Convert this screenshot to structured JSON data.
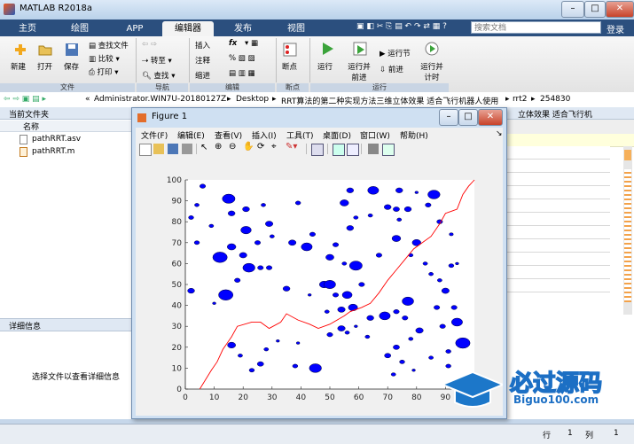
{
  "window": {
    "title": "MATLAB R2018a",
    "minimize": "–",
    "maximize": "□",
    "close": "✕"
  },
  "tabs": [
    {
      "label": "主页"
    },
    {
      "label": "绘图"
    },
    {
      "label": "APP"
    },
    {
      "label": "编辑器"
    },
    {
      "label": "发布"
    },
    {
      "label": "视图"
    }
  ],
  "search": {
    "placeholder": "搜索文档"
  },
  "login": "登录",
  "ribbon": {
    "file": {
      "new": "新建",
      "open": "打开",
      "save": "保存",
      "find_files": "查找文件",
      "compare": "比较",
      "print": "打印",
      "group": "文件"
    },
    "nav": {
      "goto": "转至",
      "find": "查找",
      "group": "导航"
    },
    "edit": {
      "insert": "插入",
      "comment": "注释",
      "indent": "缩进",
      "group": "编辑"
    },
    "breakpoints": {
      "label": "断点",
      "group": "断点"
    },
    "run": {
      "run": "运行",
      "run_advance": "运行并前进",
      "run_section": "运行节",
      "advance": "前进",
      "run_time": "运行并计时",
      "group": "运行"
    }
  },
  "address": {
    "crumbs": [
      "«",
      "Administrator.WIN7U-20180127Z",
      "Desktop",
      "RRT算法的第二种实现方法三维立体效果 适合飞行机器人使用",
      "rrt2",
      "254830"
    ]
  },
  "left_panel": {
    "title": "当前文件夹",
    "name_col": "名称",
    "files": [
      {
        "name": "pathRRT.asv"
      },
      {
        "name": "pathRRT.m"
      }
    ],
    "details_title": "详细信息",
    "details_hint": "选择文件以查看详细信息"
  },
  "right_panel": {
    "tab_text": "立体效果 适合飞行机"
  },
  "status": {
    "row_label": "行",
    "row": "1",
    "col_label": "列",
    "col": "1"
  },
  "figure": {
    "title": "Figure 1",
    "menus": [
      "文件(F)",
      "编辑(E)",
      "查看(V)",
      "插入(I)",
      "工具(T)",
      "桌面(D)",
      "窗口(W)",
      "帮助(H)"
    ]
  },
  "watermark": {
    "title": "必过源码",
    "url": "Biguo100.com"
  },
  "chart_data": {
    "type": "scatter",
    "xlim": [
      0,
      100
    ],
    "ylim": [
      0,
      100
    ],
    "xticks": [
      0,
      10,
      20,
      30,
      40,
      50,
      60,
      70,
      80,
      90
    ],
    "yticks": [
      0,
      10,
      20,
      30,
      40,
      50,
      60,
      70,
      80,
      90,
      100
    ],
    "grid": false,
    "obstacle_color": "#0000ff",
    "path_color": "#ff0000",
    "obstacles": [
      {
        "x": 6,
        "y": 97,
        "r": 1.0
      },
      {
        "x": 4,
        "y": 88,
        "r": 0.8
      },
      {
        "x": 2,
        "y": 82,
        "r": 0.9
      },
      {
        "x": 15,
        "y": 91,
        "r": 2.2
      },
      {
        "x": 21,
        "y": 86,
        "r": 1.2
      },
      {
        "x": 27,
        "y": 88,
        "r": 0.8
      },
      {
        "x": 16,
        "y": 84,
        "r": 1.2
      },
      {
        "x": 29,
        "y": 79,
        "r": 1.3
      },
      {
        "x": 21,
        "y": 76,
        "r": 1.8
      },
      {
        "x": 25,
        "y": 70,
        "r": 1.0
      },
      {
        "x": 30,
        "y": 73,
        "r": 0.8
      },
      {
        "x": 9,
        "y": 78,
        "r": 0.8
      },
      {
        "x": 4,
        "y": 70,
        "r": 0.9
      },
      {
        "x": 16,
        "y": 68,
        "r": 1.5
      },
      {
        "x": 12,
        "y": 63,
        "r": 2.5
      },
      {
        "x": 20,
        "y": 64,
        "r": 1.3
      },
      {
        "x": 26,
        "y": 58,
        "r": 1.0
      },
      {
        "x": 22,
        "y": 58,
        "r": 2.1
      },
      {
        "x": 29,
        "y": 58,
        "r": 1.0
      },
      {
        "x": 18,
        "y": 52,
        "r": 1.0
      },
      {
        "x": 2,
        "y": 47,
        "r": 1.2
      },
      {
        "x": 14,
        "y": 45,
        "r": 2.5
      },
      {
        "x": 10,
        "y": 41,
        "r": 0.6
      },
      {
        "x": 39,
        "y": 89,
        "r": 0.9
      },
      {
        "x": 57,
        "y": 95,
        "r": 1.2
      },
      {
        "x": 65,
        "y": 95,
        "r": 1.9
      },
      {
        "x": 74,
        "y": 95,
        "r": 1.2
      },
      {
        "x": 86,
        "y": 93,
        "r": 2.1
      },
      {
        "x": 80,
        "y": 94,
        "r": 0.6
      },
      {
        "x": 55,
        "y": 89,
        "r": 1.5
      },
      {
        "x": 59,
        "y": 82,
        "r": 0.8
      },
      {
        "x": 64,
        "y": 83,
        "r": 0.8
      },
      {
        "x": 74,
        "y": 81,
        "r": 0.8
      },
      {
        "x": 70,
        "y": 87,
        "r": 1.2
      },
      {
        "x": 73,
        "y": 86,
        "r": 1.1
      },
      {
        "x": 77,
        "y": 86,
        "r": 1.2
      },
      {
        "x": 84,
        "y": 88,
        "r": 1.0
      },
      {
        "x": 88,
        "y": 80,
        "r": 1.0
      },
      {
        "x": 57,
        "y": 77,
        "r": 1.2
      },
      {
        "x": 37,
        "y": 70,
        "r": 1.3
      },
      {
        "x": 44,
        "y": 74,
        "r": 1.0
      },
      {
        "x": 42,
        "y": 68,
        "r": 1.9
      },
      {
        "x": 52,
        "y": 69,
        "r": 1.0
      },
      {
        "x": 50,
        "y": 63,
        "r": 1.4
      },
      {
        "x": 59,
        "y": 59,
        "r": 2.2
      },
      {
        "x": 55,
        "y": 60,
        "r": 0.8
      },
      {
        "x": 67,
        "y": 64,
        "r": 1.0
      },
      {
        "x": 73,
        "y": 72,
        "r": 1.5
      },
      {
        "x": 80,
        "y": 70,
        "r": 1.5
      },
      {
        "x": 78,
        "y": 64,
        "r": 0.8
      },
      {
        "x": 83,
        "y": 60,
        "r": 0.8
      },
      {
        "x": 85,
        "y": 55,
        "r": 0.8
      },
      {
        "x": 88,
        "y": 52,
        "r": 0.8
      },
      {
        "x": 92,
        "y": 59,
        "r": 0.9
      },
      {
        "x": 92,
        "y": 74,
        "r": 0.7
      },
      {
        "x": 94,
        "y": 60,
        "r": 0.6
      },
      {
        "x": 48,
        "y": 50,
        "r": 1.6
      },
      {
        "x": 50,
        "y": 50,
        "r": 2.0
      },
      {
        "x": 52,
        "y": 45,
        "r": 1.0
      },
      {
        "x": 56,
        "y": 45,
        "r": 1.7
      },
      {
        "x": 61,
        "y": 50,
        "r": 1.0
      },
      {
        "x": 35,
        "y": 48,
        "r": 1.2
      },
      {
        "x": 43,
        "y": 45,
        "r": 0.6
      },
      {
        "x": 49,
        "y": 37,
        "r": 0.8
      },
      {
        "x": 54,
        "y": 38,
        "r": 1.3
      },
      {
        "x": 58,
        "y": 39,
        "r": 1.6
      },
      {
        "x": 64,
        "y": 34,
        "r": 1.2
      },
      {
        "x": 69,
        "y": 35,
        "r": 1.9
      },
      {
        "x": 73,
        "y": 37,
        "r": 1.0
      },
      {
        "x": 76,
        "y": 34,
        "r": 1.0
      },
      {
        "x": 77,
        "y": 42,
        "r": 2.0
      },
      {
        "x": 81,
        "y": 28,
        "r": 1.3
      },
      {
        "x": 78,
        "y": 24,
        "r": 0.8
      },
      {
        "x": 87,
        "y": 39,
        "r": 1.0
      },
      {
        "x": 90,
        "y": 47,
        "r": 1.3
      },
      {
        "x": 94,
        "y": 32,
        "r": 1.9
      },
      {
        "x": 93,
        "y": 39,
        "r": 1.0
      },
      {
        "x": 89,
        "y": 30,
        "r": 1.0
      },
      {
        "x": 96,
        "y": 22,
        "r": 2.5
      },
      {
        "x": 91,
        "y": 18,
        "r": 0.9
      },
      {
        "x": 91,
        "y": 11,
        "r": 0.9
      },
      {
        "x": 85,
        "y": 15,
        "r": 0.8
      },
      {
        "x": 75,
        "y": 13,
        "r": 0.9
      },
      {
        "x": 72,
        "y": 7,
        "r": 0.8
      },
      {
        "x": 79,
        "y": 9,
        "r": 0.6
      },
      {
        "x": 70,
        "y": 16,
        "r": 1.1
      },
      {
        "x": 73,
        "y": 20,
        "r": 1.1
      },
      {
        "x": 63,
        "y": 25,
        "r": 0.8
      },
      {
        "x": 54,
        "y": 29,
        "r": 1.3
      },
      {
        "x": 50,
        "y": 26,
        "r": 1.0
      },
      {
        "x": 45,
        "y": 10,
        "r": 2.1
      },
      {
        "x": 38,
        "y": 11,
        "r": 0.9
      },
      {
        "x": 32,
        "y": 23,
        "r": 0.6
      },
      {
        "x": 28,
        "y": 19,
        "r": 0.8
      },
      {
        "x": 26,
        "y": 12,
        "r": 1.1
      },
      {
        "x": 23,
        "y": 9,
        "r": 0.9
      },
      {
        "x": 19,
        "y": 16,
        "r": 0.8
      },
      {
        "x": 16,
        "y": 21,
        "r": 1.4
      },
      {
        "x": 39,
        "y": 22,
        "r": 0.6
      },
      {
        "x": 56,
        "y": 27,
        "r": 0.8
      },
      {
        "x": 59,
        "y": 30,
        "r": 0.6
      }
    ],
    "path": [
      [
        5,
        0
      ],
      [
        9,
        9
      ],
      [
        11,
        13
      ],
      [
        13,
        19
      ],
      [
        16,
        25
      ],
      [
        18,
        30
      ],
      [
        23,
        32
      ],
      [
        26,
        32
      ],
      [
        29,
        29
      ],
      [
        33,
        32
      ],
      [
        35,
        36
      ],
      [
        39,
        33
      ],
      [
        43,
        31
      ],
      [
        46,
        29
      ],
      [
        50,
        31
      ],
      [
        55,
        35
      ],
      [
        57,
        37
      ],
      [
        61,
        39
      ],
      [
        64,
        41
      ],
      [
        67,
        46
      ],
      [
        70,
        52
      ],
      [
        73,
        57
      ],
      [
        76,
        62
      ],
      [
        79,
        67
      ],
      [
        82,
        70
      ],
      [
        85,
        73
      ],
      [
        88,
        79
      ],
      [
        90,
        84
      ],
      [
        94,
        86
      ],
      [
        96,
        93
      ],
      [
        98,
        97
      ],
      [
        100,
        100
      ]
    ]
  }
}
